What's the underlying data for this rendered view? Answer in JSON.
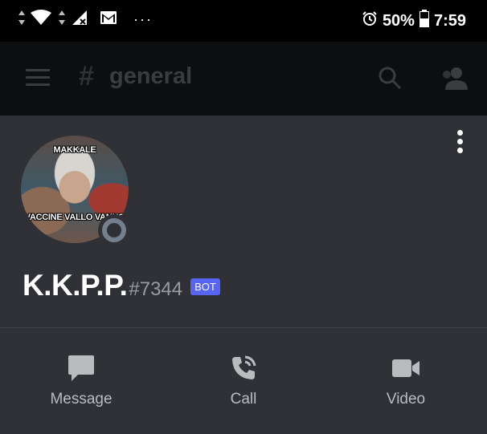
{
  "status_bar": {
    "battery": "50%",
    "time": "7:59",
    "overflow_dots": "···"
  },
  "channel_header": {
    "hash": "#",
    "channel_name": "general"
  },
  "profile": {
    "avatar_top_text": "MAKKALE",
    "avatar_bottom_text": "VACCINE VALLO VANNO",
    "username": "K.K.P.P.",
    "discriminator": "#7344",
    "badge": "BOT",
    "status": "offline"
  },
  "actions": [
    {
      "label": "Message",
      "icon": "chat-bubble-icon"
    },
    {
      "label": "Call",
      "icon": "phone-icon"
    },
    {
      "label": "Video",
      "icon": "video-camera-icon"
    }
  ],
  "colors": {
    "blurple": "#5865f2",
    "sheet_bg": "#2f3136",
    "offline_grey": "#747f8d"
  }
}
